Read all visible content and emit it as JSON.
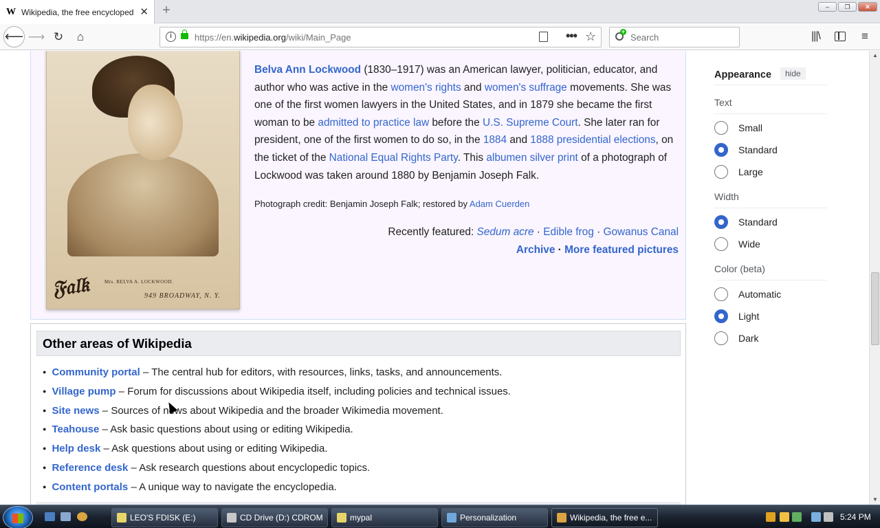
{
  "browser": {
    "tab_title": "Wikipedia, the free encycloped",
    "tab_favicon": "W",
    "url_host_prefix": "https://en.",
    "url_host": "wikipedia.org",
    "url_path": "/wiki/Main_Page",
    "search_placeholder": "Search",
    "new_tab_label": "+",
    "menu_icon": "≡"
  },
  "potd": {
    "photo_caption_name": "Mrs. BELVA A. LOCKWOOD.",
    "photo_caption_address": "949 BROADWAY, N. Y.",
    "photo_signature": "Falk",
    "subject_link": "Belva Ann Lockwood",
    "t1": " (1830–1917) was an American lawyer, politician, educator, and author who was active in the ",
    "l1": "women's rights",
    "t2": " and ",
    "l2": "women's suffrage",
    "t3": " movements. She was one of the first women lawyers in the United States, and in 1879 she became the first woman to be ",
    "l3": "admitted to practice law",
    "t4": " before the ",
    "l4": "U.S. Supreme Court",
    "t5": ". She later ran for president, one of the first women to do so, in the ",
    "l5": "1884",
    "t6": " and ",
    "l6": "1888 presidential elections",
    "t7": ", on the ticket of the ",
    "l7": "National Equal Rights Party",
    "t8": ". This ",
    "l8": "albumen silver print",
    "t9": " of a photograph of Lockwood was taken around 1880 by Benjamin Joseph Falk.",
    "credit_text": "Photograph credit: Benjamin Joseph Falk; restored by ",
    "credit_link": "Adam Cuerden",
    "recent_label": "Recently featured: ",
    "recent_items": [
      "Sedum acre",
      "Edible frog",
      "Gowanus Canal"
    ],
    "sep": " · ",
    "archive_link": "Archive",
    "more_link": "More featured pictures"
  },
  "other_areas": {
    "heading": "Other areas of Wikipedia",
    "items": [
      {
        "link": "Community portal",
        "text": " – The central hub for editors, with resources, links, tasks, and announcements."
      },
      {
        "link": "Village pump",
        "text": " – Forum for discussions about Wikipedia itself, including policies and technical issues."
      },
      {
        "link": "Site news",
        "text": " – Sources of news about Wikipedia and the broader Wikimedia movement."
      },
      {
        "link": "Teahouse",
        "text": " – Ask basic questions about using or editing Wikipedia."
      },
      {
        "link": "Help desk",
        "text": " – Ask questions about using or editing Wikipedia."
      },
      {
        "link": "Reference desk",
        "text": " – Ask research questions about encyclopedic topics."
      },
      {
        "link": "Content portals",
        "text": " – A unique way to navigate the encyclopedia."
      }
    ]
  },
  "appearance": {
    "title": "Appearance",
    "hide_label": "hide",
    "text_label": "Text",
    "text_options": [
      "Small",
      "Standard",
      "Large"
    ],
    "text_selected": "Standard",
    "width_label": "Width",
    "width_options": [
      "Standard",
      "Wide"
    ],
    "width_selected": "Standard",
    "color_label": "Color (beta)",
    "color_options": [
      "Automatic",
      "Light",
      "Dark"
    ],
    "color_selected": "Light"
  },
  "taskbar": {
    "items": [
      {
        "label": "LEO'S FDISK (E:)",
        "icon_color": "#e8d56a"
      },
      {
        "label": "CD Drive (D:) CDROM",
        "icon_color": "#c8c8c8"
      },
      {
        "label": "mypal",
        "icon_color": "#e8d56a"
      },
      {
        "label": "Personalization",
        "icon_color": "#6fa8dc"
      },
      {
        "label": "Wikipedia, the free e...",
        "icon_color": "#d9a441"
      }
    ],
    "clock": "5:24 PM"
  },
  "colors": {
    "link": "#3366cc",
    "lock_green": "#12bc00",
    "potd_background": "#faf5ff"
  }
}
